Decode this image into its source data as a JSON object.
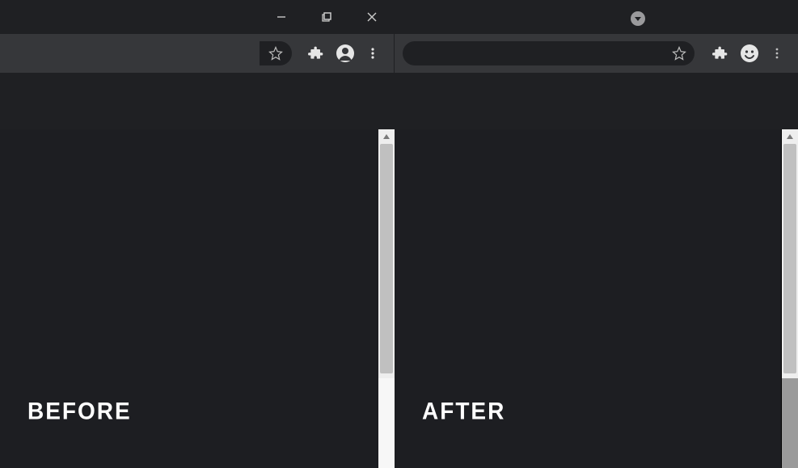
{
  "window": {
    "minimize_label": "Minimize",
    "maximize_label": "Maximize",
    "close_label": "Close"
  },
  "toolbar": {
    "star_label": "Bookmark",
    "extensions_label": "Extensions",
    "profile_label": "Profile",
    "menu_label": "Menu"
  },
  "panes": {
    "left_label": "BEFORE",
    "right_label": "AFTER"
  }
}
